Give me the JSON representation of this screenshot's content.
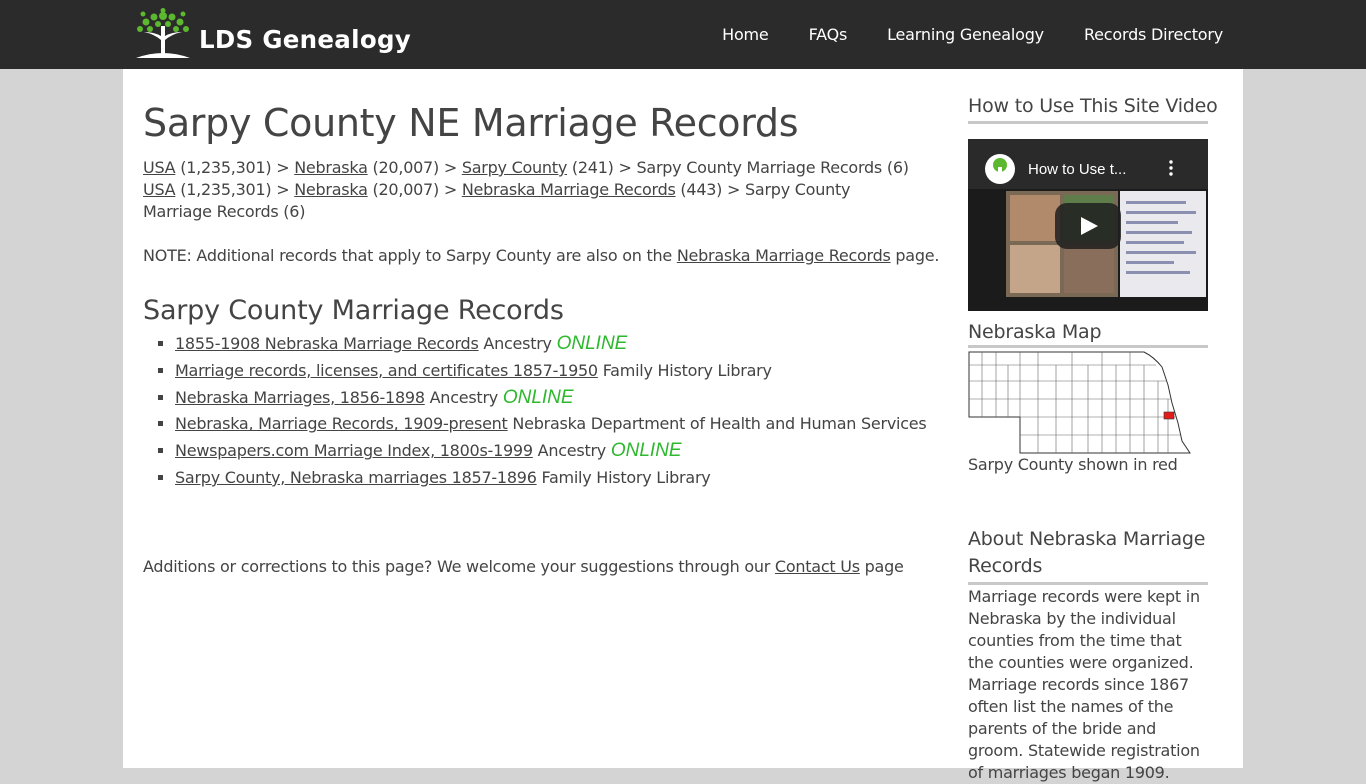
{
  "header": {
    "logo_text": "LDS Genealogy",
    "nav": [
      "Home",
      "FAQs",
      "Learning Genealogy",
      "Records Directory"
    ]
  },
  "main": {
    "title": "Sarpy County NE Marriage Records",
    "breadcrumb1": {
      "usa": "USA",
      "usa_count": " (1,235,301) > ",
      "state": "Nebraska",
      "state_count": " (20,007) > ",
      "county": "Sarpy County",
      "county_count": " (241) > ",
      "current": "Sarpy County Marriage Records (6)"
    },
    "breadcrumb2": {
      "usa": "USA",
      "usa_count": " (1,235,301) > ",
      "state": "Nebraska",
      "state_count": " (20,007) > ",
      "topic": "Nebraska Marriage Records",
      "topic_count": " (443) > ",
      "current": "Sarpy County Marriage Records (6)"
    },
    "note": {
      "prefix": "NOTE: Additional records that apply to Sarpy County are also on the ",
      "link": "Nebraska Marriage Records",
      "suffix": " page."
    },
    "section_title": "Sarpy County Marriage Records",
    "online_label": "ONLINE",
    "records": [
      {
        "link": "1855-1908 Nebraska Marriage Records",
        "source": " Ancestry ",
        "online": true
      },
      {
        "link": "Marriage records, licenses, and certificates 1857-1950",
        "source": " Family History Library",
        "online": false
      },
      {
        "link": "Nebraska Marriages, 1856-1898",
        "source": " Ancestry ",
        "online": true
      },
      {
        "link": "Nebraska, Marriage Records, 1909-present",
        "source": " Nebraska Department of Health and Human Services",
        "online": false
      },
      {
        "link": "Newspapers.com Marriage Index, 1800s-1999",
        "source": " Ancestry ",
        "online": true
      },
      {
        "link": "Sarpy County, Nebraska marriages 1857-1896",
        "source": " Family History Library",
        "online": false
      }
    ],
    "footer": {
      "prefix": "Additions or corrections to this page? We welcome your suggestions through our ",
      "link": "Contact Us",
      "suffix": " page"
    }
  },
  "sidebar": {
    "video_heading": "How to Use This Site Video",
    "video_title": "How to Use t...",
    "map_heading": "Nebraska Map",
    "map_caption": "Sarpy County shown in red",
    "about_heading": "About Nebraska Marriage Records",
    "about_text": "Marriage records were kept in Nebraska by the individual counties from the time that the counties were organized. Marriage records since 1867 often list the names of the parents of the bride and groom. Statewide registration of marriages began 1909."
  },
  "colors": {
    "header_bg": "#2b2b2b",
    "page_bg": "#d4d4d4",
    "online_green": "#2db82d",
    "highlight_county": "#e31b1b"
  }
}
